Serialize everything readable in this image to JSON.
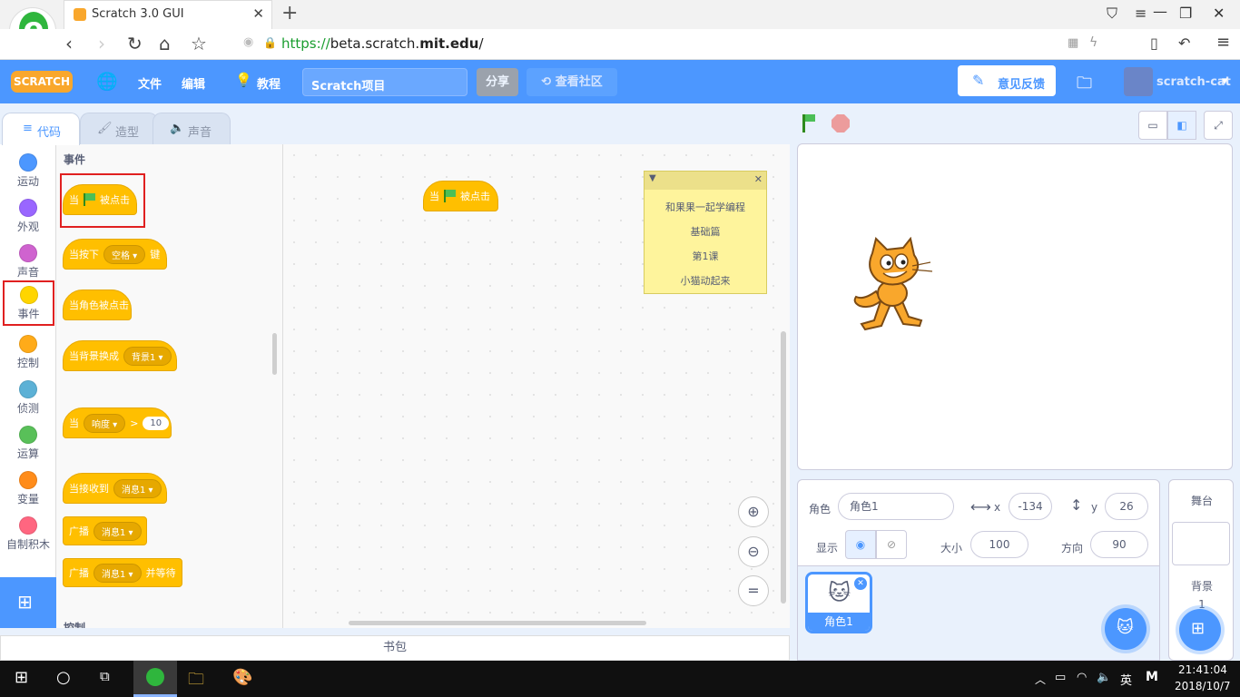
{
  "browser": {
    "tab_title": "Scratch 3.0 GUI",
    "url_scheme": "https://",
    "url_host": "beta.scratch.",
    "url_domain": "mit.edu",
    "url_path": "/"
  },
  "menu": {
    "logo": "SCRATCH",
    "file": "文件",
    "edit": "编辑",
    "tutorials": "教程",
    "project_title": "Scratch项目",
    "share": "分享",
    "see_community": "查看社区",
    "feedback": "意见反馈",
    "username": "scratch-cat"
  },
  "editor_tabs": [
    "代码",
    "造型",
    "声音"
  ],
  "categories": [
    {
      "label": "运动",
      "color": "#4c97ff"
    },
    {
      "label": "外观",
      "color": "#9966ff"
    },
    {
      "label": "声音",
      "color": "#cf63cf"
    },
    {
      "label": "事件",
      "color": "#ffd500"
    },
    {
      "label": "控制",
      "color": "#ffab19"
    },
    {
      "label": "侦测",
      "color": "#5cb1d6"
    },
    {
      "label": "运算",
      "color": "#59c059"
    },
    {
      "label": "变量",
      "color": "#ff8c1a"
    },
    {
      "label": "自制积木",
      "color": "#ff6680"
    }
  ],
  "palette": {
    "section_title": "事件",
    "next_section": "控制",
    "b1_when": "当",
    "b1_clicked": "被点击",
    "b2_prefix": "当按下",
    "b2_key": "空格",
    "b2_suffix": "键",
    "b3": "当角色被点击",
    "b4_prefix": "当背景换成",
    "b4_backdrop": "背景1",
    "b5_when": "当",
    "b5_sensor": "响度",
    "b5_op": ">",
    "b5_value": "10",
    "b6_prefix": "当接收到",
    "b6_msg": "消息1",
    "b7_prefix": "广播",
    "b7_msg": "消息1",
    "b8_prefix": "广播",
    "b8_msg": "消息1",
    "b8_suffix": "并等待"
  },
  "workspace": {
    "block_when": "当",
    "block_clicked": "被点击",
    "note_lines": [
      "和果果一起学编程",
      "基础篇",
      "第1课",
      "小猫动起来"
    ]
  },
  "backpack": "书包",
  "sprite": {
    "label_sprite": "角色",
    "name": "角色1",
    "x_label": "x",
    "x": "-134",
    "y_label": "y",
    "y": "26",
    "show_label": "显示",
    "size_label": "大小",
    "size": "100",
    "direction_label": "方向",
    "direction": "90",
    "thumb_name": "角色1"
  },
  "stage_panel": {
    "title": "舞台",
    "backdrops_label": "背景",
    "backdrops_count": "1"
  },
  "taskbar": {
    "ime": "英",
    "time": "21:41:04",
    "date": "2018/10/7"
  }
}
